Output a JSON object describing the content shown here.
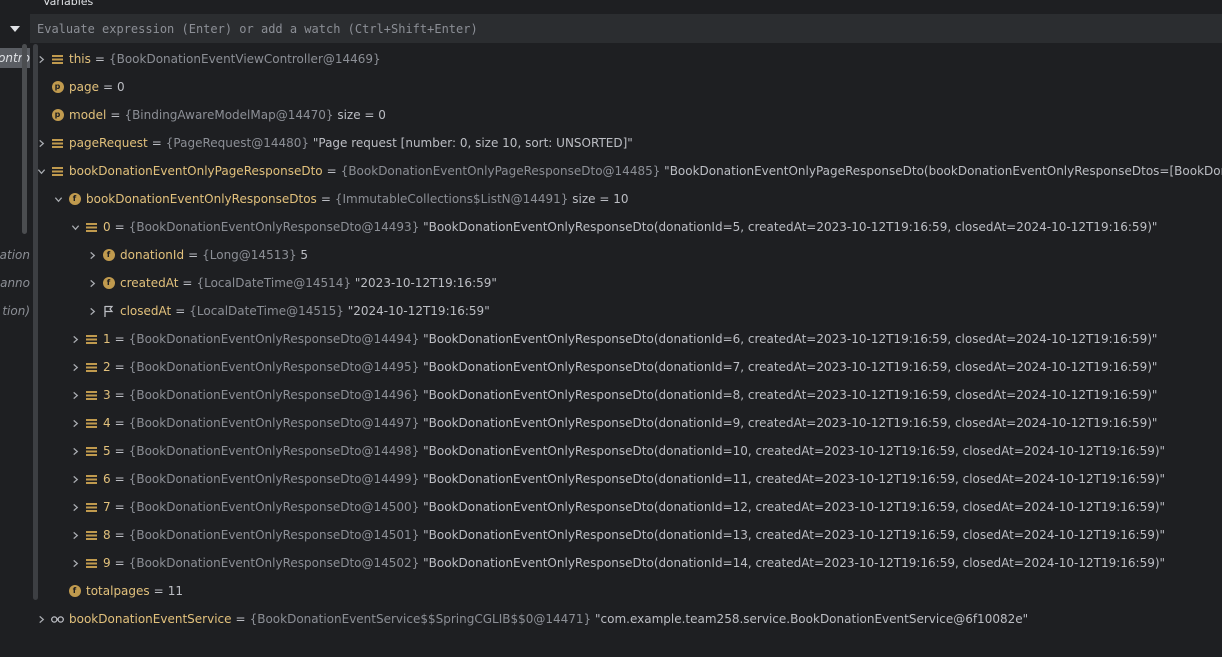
{
  "panel": {
    "title": "Variables"
  },
  "eval": {
    "placeholder": "Evaluate expression (Enter) or add a watch (Ctrl+Shift+Enter)"
  },
  "frames": [
    {
      "label": "Contro",
      "active": true
    },
    {
      "label": "otation",
      "active": false
    },
    {
      "label": "l.anno",
      "active": false
    },
    {
      "label": "tion)",
      "active": false
    }
  ],
  "tree": [
    {
      "depth": 0,
      "arrow": "collapsed",
      "icon": "lines",
      "name": "this",
      "type": "{BookDonationEventViewController@14469}",
      "value": ""
    },
    {
      "depth": 0,
      "arrow": "none",
      "icon": "p",
      "name": "page",
      "type": "",
      "value": "0"
    },
    {
      "depth": 0,
      "arrow": "none",
      "icon": "p",
      "name": "model",
      "type": "{BindingAwareModelMap@14470}",
      "value": " size = 0"
    },
    {
      "depth": 0,
      "arrow": "collapsed",
      "icon": "lines",
      "name": "pageRequest",
      "type": "{PageRequest@14480}",
      "value": " \"Page request [number: 0, size 10, sort: UNSORTED]\""
    },
    {
      "depth": 0,
      "arrow": "expanded",
      "icon": "lines",
      "name": "bookDonationEventOnlyPageResponseDto",
      "type": "{BookDonationEventOnlyPageResponseDto@14485}",
      "value": " \"BookDonationEventOnlyPageResponseDto(bookDonationEventOnlyResponseDtos=[BookDonationEventOnlyResponseDto(donationId=5, createdAt=2023-10-12T19:16:59"
    },
    {
      "depth": 1,
      "arrow": "expanded",
      "icon": "f",
      "name": "bookDonationEventOnlyResponseDtos",
      "type": "{ImmutableCollections$ListN@14491}",
      "value": " size = 10"
    },
    {
      "depth": 2,
      "arrow": "expanded",
      "icon": "lines",
      "name": "0",
      "type": "{BookDonationEventOnlyResponseDto@14493}",
      "value": " \"BookDonationEventOnlyResponseDto(donationId=5, createdAt=2023-10-12T19:16:59, closedAt=2024-10-12T19:16:59)\""
    },
    {
      "depth": 3,
      "arrow": "collapsed",
      "icon": "f",
      "name": "donationId",
      "type": "{Long@14513}",
      "value": " 5"
    },
    {
      "depth": 3,
      "arrow": "collapsed",
      "icon": "f",
      "name": "createdAt",
      "type": "{LocalDateTime@14514}",
      "value": " \"2023-10-12T19:16:59\""
    },
    {
      "depth": 3,
      "arrow": "collapsed",
      "icon": "flag",
      "name": "closedAt",
      "type": "{LocalDateTime@14515}",
      "value": " \"2024-10-12T19:16:59\""
    },
    {
      "depth": 2,
      "arrow": "collapsed",
      "icon": "lines",
      "name": "1",
      "type": "{BookDonationEventOnlyResponseDto@14494}",
      "value": " \"BookDonationEventOnlyResponseDto(donationId=6, createdAt=2023-10-12T19:16:59, closedAt=2024-10-12T19:16:59)\""
    },
    {
      "depth": 2,
      "arrow": "collapsed",
      "icon": "lines",
      "name": "2",
      "type": "{BookDonationEventOnlyResponseDto@14495}",
      "value": " \"BookDonationEventOnlyResponseDto(donationId=7, createdAt=2023-10-12T19:16:59, closedAt=2024-10-12T19:16:59)\""
    },
    {
      "depth": 2,
      "arrow": "collapsed",
      "icon": "lines",
      "name": "3",
      "type": "{BookDonationEventOnlyResponseDto@14496}",
      "value": " \"BookDonationEventOnlyResponseDto(donationId=8, createdAt=2023-10-12T19:16:59, closedAt=2024-10-12T19:16:59)\""
    },
    {
      "depth": 2,
      "arrow": "collapsed",
      "icon": "lines",
      "name": "4",
      "type": "{BookDonationEventOnlyResponseDto@14497}",
      "value": " \"BookDonationEventOnlyResponseDto(donationId=9, createdAt=2023-10-12T19:16:59, closedAt=2024-10-12T19:16:59)\""
    },
    {
      "depth": 2,
      "arrow": "collapsed",
      "icon": "lines",
      "name": "5",
      "type": "{BookDonationEventOnlyResponseDto@14498}",
      "value": " \"BookDonationEventOnlyResponseDto(donationId=10, createdAt=2023-10-12T19:16:59, closedAt=2024-10-12T19:16:59)\""
    },
    {
      "depth": 2,
      "arrow": "collapsed",
      "icon": "lines",
      "name": "6",
      "type": "{BookDonationEventOnlyResponseDto@14499}",
      "value": " \"BookDonationEventOnlyResponseDto(donationId=11, createdAt=2023-10-12T19:16:59, closedAt=2024-10-12T19:16:59)\""
    },
    {
      "depth": 2,
      "arrow": "collapsed",
      "icon": "lines",
      "name": "7",
      "type": "{BookDonationEventOnlyResponseDto@14500}",
      "value": " \"BookDonationEventOnlyResponseDto(donationId=12, createdAt=2023-10-12T19:16:59, closedAt=2024-10-12T19:16:59)\""
    },
    {
      "depth": 2,
      "arrow": "collapsed",
      "icon": "lines",
      "name": "8",
      "type": "{BookDonationEventOnlyResponseDto@14501}",
      "value": " \"BookDonationEventOnlyResponseDto(donationId=13, createdAt=2023-10-12T19:16:59, closedAt=2024-10-12T19:16:59)\""
    },
    {
      "depth": 2,
      "arrow": "collapsed",
      "icon": "lines",
      "name": "9",
      "type": "{BookDonationEventOnlyResponseDto@14502}",
      "value": " \"BookDonationEventOnlyResponseDto(donationId=14, createdAt=2023-10-12T19:16:59, closedAt=2024-10-12T19:16:59)\""
    },
    {
      "depth": 1,
      "arrow": "none",
      "icon": "f",
      "name": "totalpages",
      "type": "",
      "value": "11"
    },
    {
      "depth": 0,
      "arrow": "collapsed",
      "icon": "glasses",
      "name": "bookDonationEventService",
      "type": "{BookDonationEventService$$SpringCGLIB$$0@14471}",
      "value": " \"com.example.team258.service.BookDonationEventService@6f10082e\""
    }
  ]
}
